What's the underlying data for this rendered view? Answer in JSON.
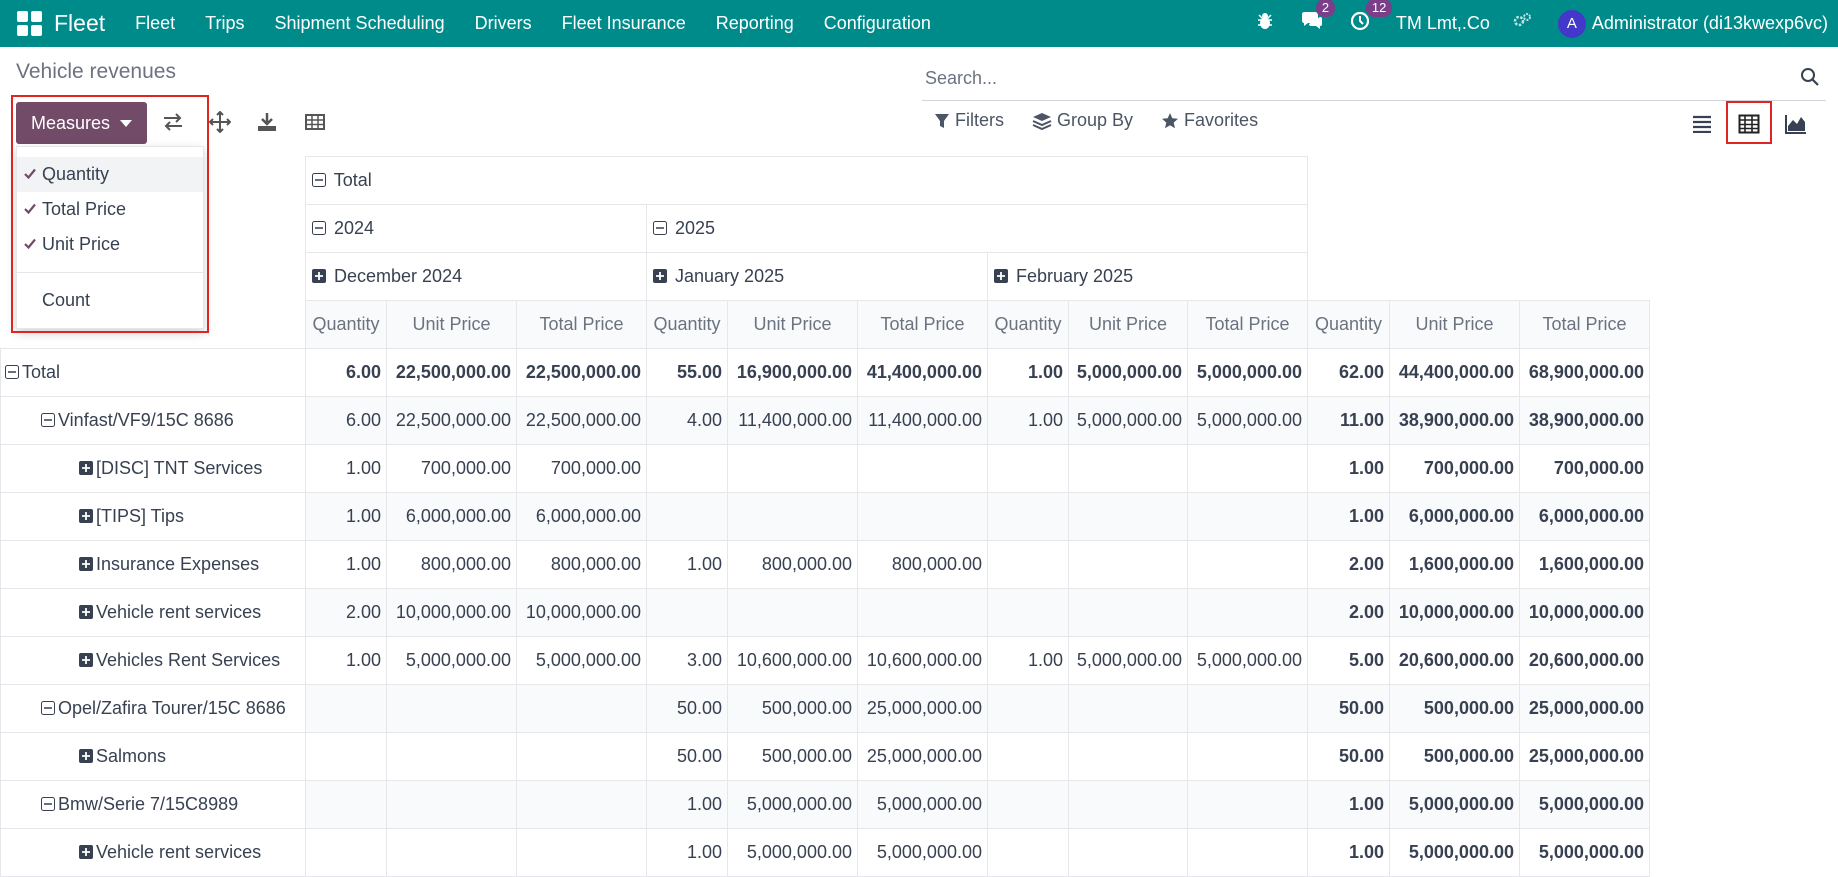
{
  "navbar": {
    "brand": "Fleet",
    "menu": [
      "Fleet",
      "Trips",
      "Shipment Scheduling",
      "Drivers",
      "Fleet Insurance",
      "Reporting",
      "Configuration"
    ],
    "messages_count": "2",
    "activities_count": "12",
    "company": "TM Lmt,.Co",
    "avatar_letter": "A",
    "user": "Administrator (di13kwexp6vc)"
  },
  "page": {
    "title": "Vehicle revenues",
    "search_placeholder": "Search...",
    "measures_label": "Measures",
    "filters_label": "Filters",
    "groupby_label": "Group By",
    "favorites_label": "Favorites"
  },
  "measures_menu": [
    {
      "label": "Quantity",
      "checked": true
    },
    {
      "label": "Total Price",
      "checked": true
    },
    {
      "label": "Unit Price",
      "checked": true
    },
    {
      "label": "Count",
      "checked": false
    }
  ],
  "pivot": {
    "col_total": "Total",
    "year_2024": "2024",
    "year_2025": "2025",
    "months": [
      "December 2024",
      "January 2025",
      "February 2025"
    ],
    "measures": [
      "Quantity",
      "Unit Price",
      "Total Price"
    ],
    "rows": [
      {
        "label": "Total",
        "level": 0,
        "icon": "minus",
        "bold": true,
        "cells": [
          "6.00",
          "22,500,000.00",
          "22,500,000.00",
          "55.00",
          "16,900,000.00",
          "41,400,000.00",
          "1.00",
          "5,000,000.00",
          "5,000,000.00",
          "62.00",
          "44,400,000.00",
          "68,900,000.00"
        ]
      },
      {
        "label": "Vinfast/VF9/15C 8686",
        "level": 1,
        "icon": "minus",
        "bold": false,
        "cells": [
          "6.00",
          "22,500,000.00",
          "22,500,000.00",
          "4.00",
          "11,400,000.00",
          "11,400,000.00",
          "1.00",
          "5,000,000.00",
          "5,000,000.00",
          "11.00",
          "38,900,000.00",
          "38,900,000.00"
        ]
      },
      {
        "label": "[DISC] TNT Services",
        "level": 2,
        "icon": "plus",
        "bold": false,
        "cells": [
          "1.00",
          "700,000.00",
          "700,000.00",
          "",
          "",
          "",
          "",
          "",
          "",
          "1.00",
          "700,000.00",
          "700,000.00"
        ]
      },
      {
        "label": "[TIPS] Tips",
        "level": 2,
        "icon": "plus",
        "bold": false,
        "cells": [
          "1.00",
          "6,000,000.00",
          "6,000,000.00",
          "",
          "",
          "",
          "",
          "",
          "",
          "1.00",
          "6,000,000.00",
          "6,000,000.00"
        ]
      },
      {
        "label": "Insurance Expenses",
        "level": 2,
        "icon": "plus",
        "bold": false,
        "cells": [
          "1.00",
          "800,000.00",
          "800,000.00",
          "1.00",
          "800,000.00",
          "800,000.00",
          "",
          "",
          "",
          "2.00",
          "1,600,000.00",
          "1,600,000.00"
        ]
      },
      {
        "label": "Vehicle rent services",
        "level": 2,
        "icon": "plus",
        "bold": false,
        "cells": [
          "2.00",
          "10,000,000.00",
          "10,000,000.00",
          "",
          "",
          "",
          "",
          "",
          "",
          "2.00",
          "10,000,000.00",
          "10,000,000.00"
        ]
      },
      {
        "label": "Vehicles Rent Services",
        "level": 2,
        "icon": "plus",
        "bold": false,
        "cells": [
          "1.00",
          "5,000,000.00",
          "5,000,000.00",
          "3.00",
          "10,600,000.00",
          "10,600,000.00",
          "1.00",
          "5,000,000.00",
          "5,000,000.00",
          "5.00",
          "20,600,000.00",
          "20,600,000.00"
        ]
      },
      {
        "label": "Opel/Zafira Tourer/15C 8686",
        "level": 1,
        "icon": "minus",
        "bold": false,
        "cells": [
          "",
          "",
          "",
          "50.00",
          "500,000.00",
          "25,000,000.00",
          "",
          "",
          "",
          "50.00",
          "500,000.00",
          "25,000,000.00"
        ]
      },
      {
        "label": "Salmons",
        "level": 2,
        "icon": "plus",
        "bold": false,
        "cells": [
          "",
          "",
          "",
          "50.00",
          "500,000.00",
          "25,000,000.00",
          "",
          "",
          "",
          "50.00",
          "500,000.00",
          "25,000,000.00"
        ]
      },
      {
        "label": "Bmw/Serie 7/15C8989",
        "level": 1,
        "icon": "minus",
        "bold": false,
        "cells": [
          "",
          "",
          "",
          "1.00",
          "5,000,000.00",
          "5,000,000.00",
          "",
          "",
          "",
          "1.00",
          "5,000,000.00",
          "5,000,000.00"
        ]
      },
      {
        "label": "Vehicle rent services",
        "level": 2,
        "icon": "plus",
        "bold": false,
        "cells": [
          "",
          "",
          "",
          "1.00",
          "5,000,000.00",
          "5,000,000.00",
          "",
          "",
          "",
          "1.00",
          "5,000,000.00",
          "5,000,000.00"
        ]
      }
    ]
  },
  "colors": {
    "navbar": "#008b8b",
    "primary": "#714b67",
    "highlight": "#e02424"
  }
}
